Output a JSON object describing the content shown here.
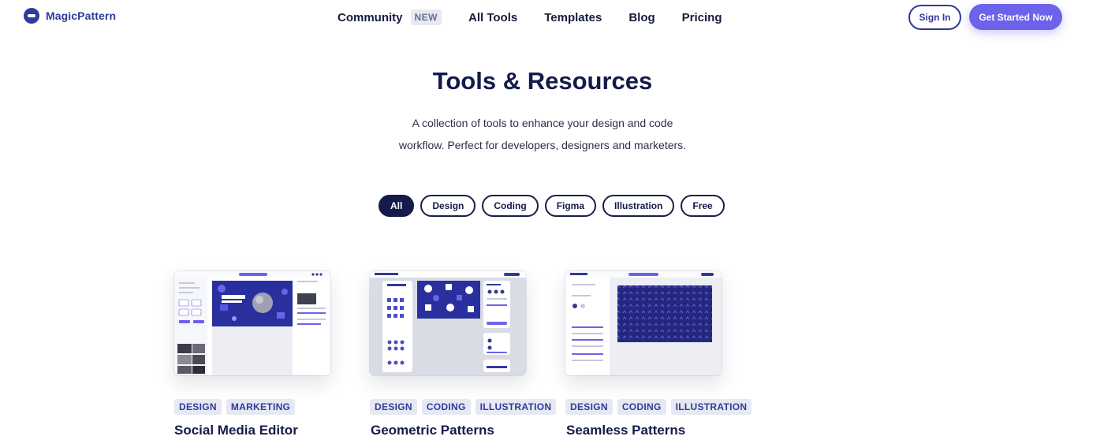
{
  "brand": {
    "name": "MagicPattern",
    "accent": "#6c63ea",
    "navy": "#141a4a"
  },
  "nav": {
    "items": [
      {
        "label": "Community",
        "badge": "NEW"
      },
      {
        "label": "All Tools"
      },
      {
        "label": "Templates"
      },
      {
        "label": "Blog"
      },
      {
        "label": "Pricing"
      }
    ],
    "signin": "Sign In",
    "get_started": "Get Started Now"
  },
  "hero": {
    "title": "Tools & Resources",
    "subtitle_line1": "A collection of tools to enhance your design and code",
    "subtitle_line2": "workflow. Perfect for developers, designers and marketers."
  },
  "filters": [
    {
      "label": "All",
      "active": true
    },
    {
      "label": "Design",
      "active": false
    },
    {
      "label": "Coding",
      "active": false
    },
    {
      "label": "Figma",
      "active": false
    },
    {
      "label": "Illustration",
      "active": false
    },
    {
      "label": "Free",
      "active": false
    }
  ],
  "cards": [
    {
      "title": "Social Media Editor",
      "tags": [
        "DESIGN",
        "MARKETING"
      ],
      "preview": "social-media-editor-preview"
    },
    {
      "title": "Geometric Patterns",
      "tags": [
        "DESIGN",
        "CODING",
        "ILLUSTRATION"
      ],
      "preview": "geometric-patterns-preview"
    },
    {
      "title": "Seamless Patterns",
      "tags": [
        "DESIGN",
        "CODING",
        "ILLUSTRATION"
      ],
      "preview": "seamless-patterns-preview"
    }
  ]
}
